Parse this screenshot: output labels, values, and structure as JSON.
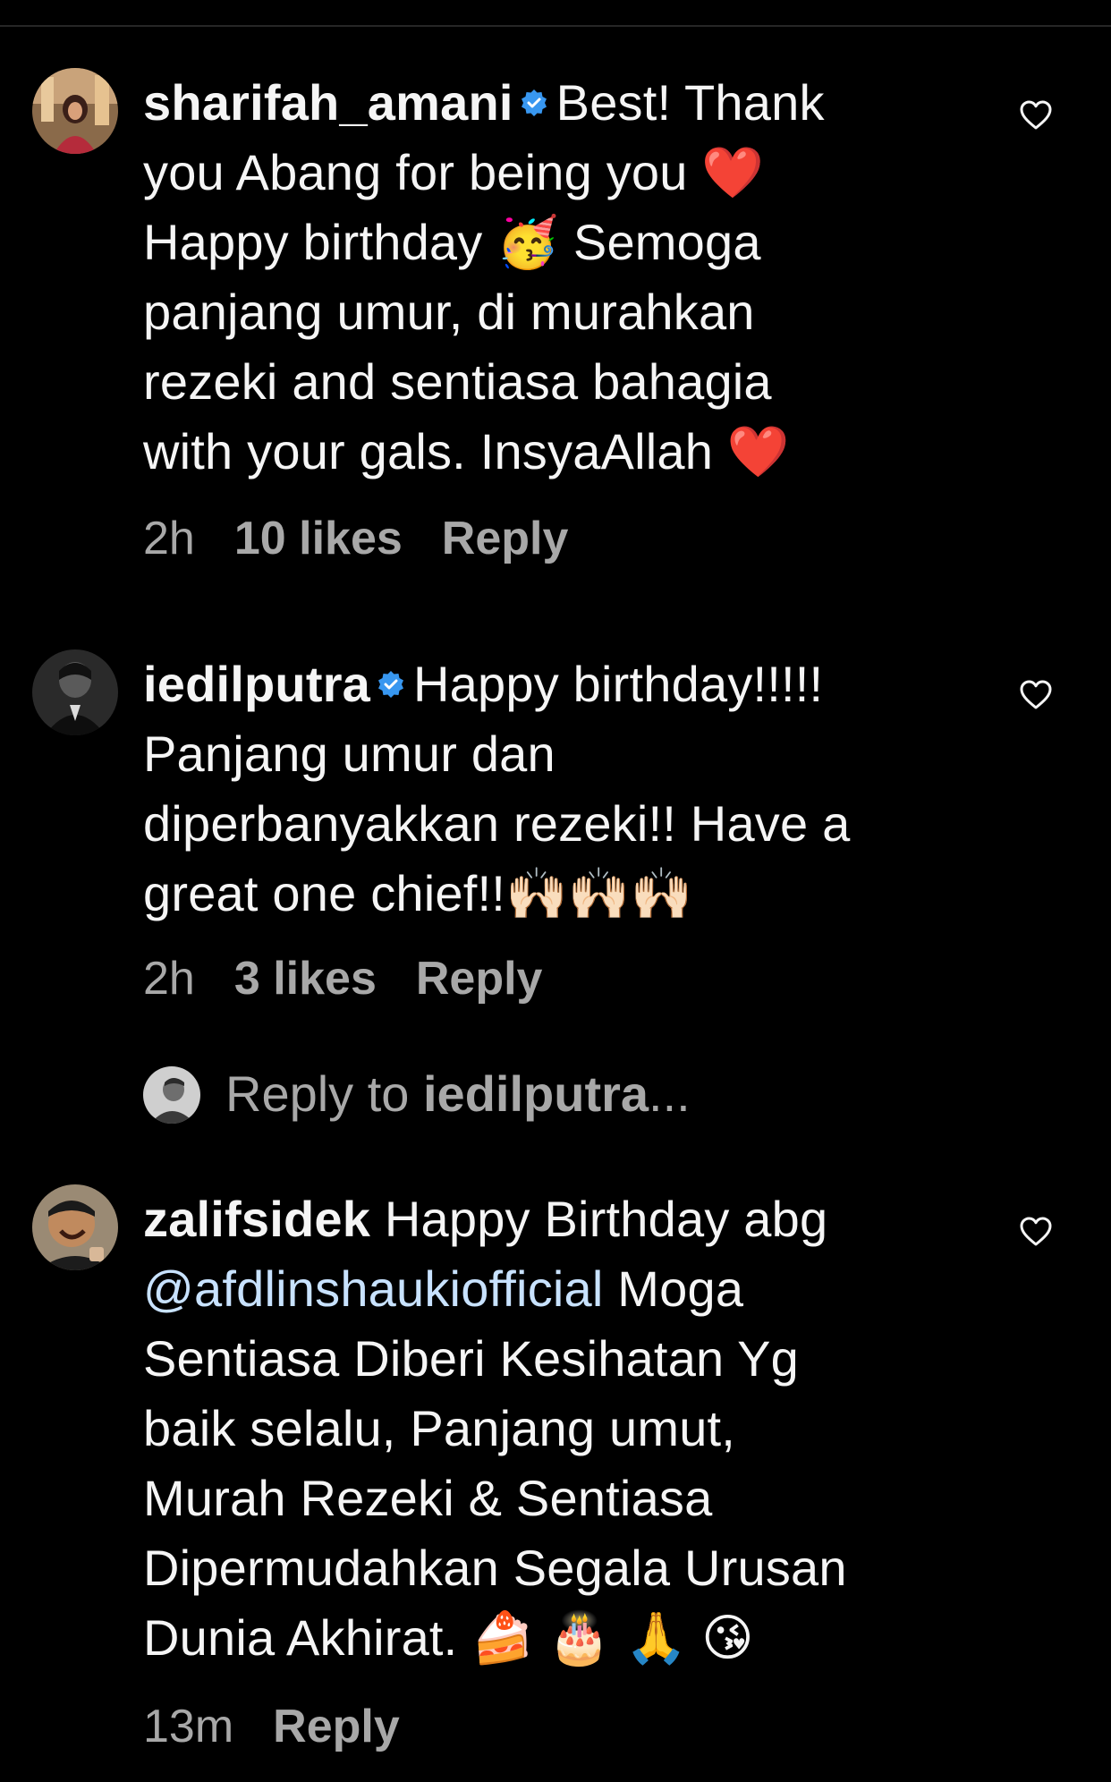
{
  "comments": [
    {
      "username": "sharifah_amani",
      "verified": true,
      "lines": [
        "Best! Thank",
        "you Abang for being you ❤️",
        "Happy birthday 🥳 Semoga",
        "panjang umur, di murahkan",
        "rezeki and sentiasa bahagia",
        "with your gals. InsyaAllah ❤️"
      ],
      "time": "2h",
      "likes": "10 likes",
      "reply_label": "Reply"
    },
    {
      "username": "iedilputra",
      "verified": true,
      "lines": [
        "Happy birthday!!!!!",
        "Panjang umur dan",
        "diperbanyakkan rezeki!! Have a",
        "great one chief!!🙌🏻🙌🏻🙌🏻"
      ],
      "time": "2h",
      "likes": "3 likes",
      "reply_label": "Reply"
    },
    {
      "username": "zalifsidek",
      "verified": false,
      "lines": [
        "Happy Birthday abg",
        "@afdlinshaukiofficial Moga",
        "Sentiasa Diberi Kesihatan Yg",
        "baik selalu, Panjang umut,",
        "Murah Rezeki & Sentiasa",
        "Dipermudahkan Segala Urusan",
        "Dunia Akhirat. 🍰 🎂 🙏 😘"
      ],
      "time": "13m",
      "reply_label": "Reply"
    }
  ],
  "reply_prompt": {
    "prefix": "Reply to ",
    "username": "iedilputra",
    "suffix": "..."
  },
  "icons": {
    "like": "heart-icon",
    "verified": "verified-badge-icon"
  },
  "colors": {
    "background": "#000000",
    "text": "#f5f5f5",
    "muted": "#a8a8a8",
    "verified": "#3897f0",
    "mention": "#c8e2ff"
  }
}
